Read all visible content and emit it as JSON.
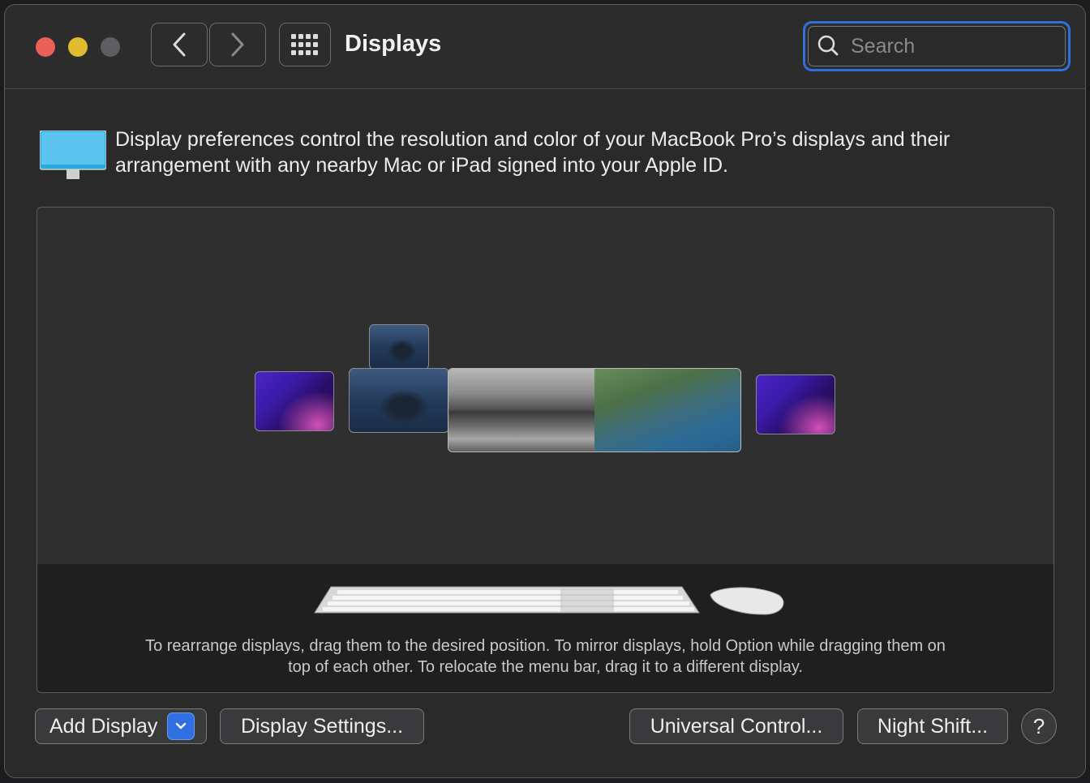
{
  "window": {
    "title": "Displays",
    "search_placeholder": "Search"
  },
  "intro": {
    "text": "Display preferences control the resolution and color of your MacBook Pro’s displays and their arrangement with any nearby Mac or iPad signed into your Apple ID."
  },
  "arrangement": {
    "hint": "To rearrange displays, drag them to the desired position. To mirror displays, hold Option while dragging them on top of each other. To relocate the menu bar, drag it to a different display."
  },
  "buttons": {
    "add_display": "Add Display",
    "display_settings": "Display Settings...",
    "universal_control": "Universal Control...",
    "night_shift": "Night Shift...",
    "help": "?"
  },
  "icons": {
    "back": "chevron-left-icon",
    "forward": "chevron-right-icon",
    "grid": "grid-icon",
    "search": "search-icon",
    "display": "display-icon"
  },
  "colors": {
    "accent": "#2f6fe0",
    "close": "#ec5f57",
    "minimize": "#e0bc2f"
  }
}
